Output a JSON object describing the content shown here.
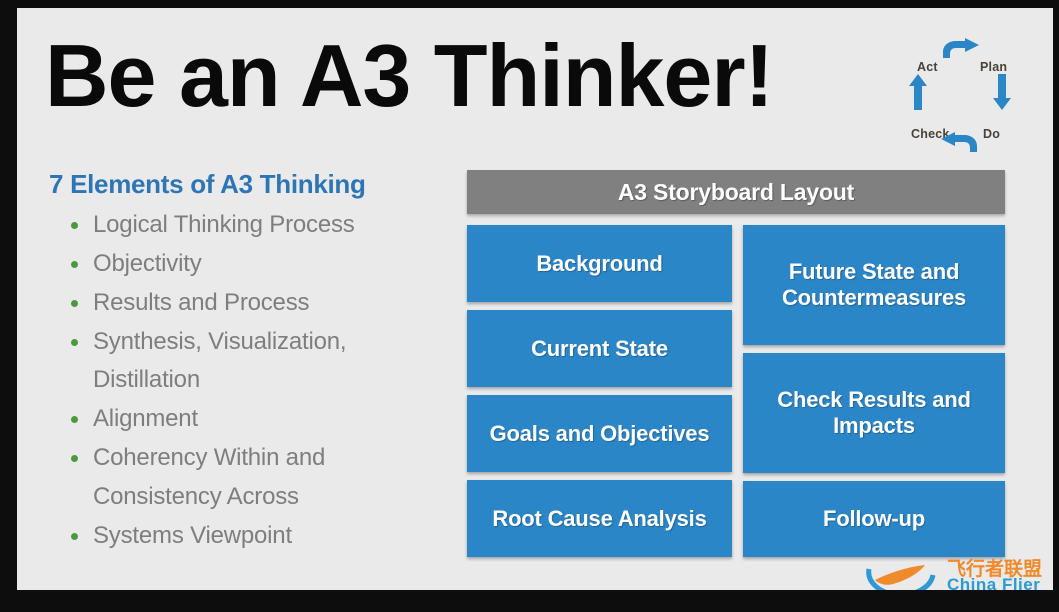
{
  "slide": {
    "title": "Be an A3 Thinker!",
    "background_color": "#eaeaea",
    "frame_color": "#0d0d0d"
  },
  "pdca": {
    "labels": {
      "act": "Act",
      "plan": "Plan",
      "check": "Check",
      "do": "Do"
    },
    "arrow_color": "#2b86c8",
    "label_color": "#4a4238",
    "icons": {
      "top": "arrow-right-icon",
      "right": "arrow-down-icon",
      "bottom": "arrow-left-icon",
      "left": "arrow-up-icon"
    }
  },
  "elements": {
    "heading": "7 Elements of A3 Thinking",
    "heading_color": "#2e75b6",
    "bullet_color": "#4a9a3c",
    "text_color": "#7e7e7e",
    "items": [
      {
        "line1": "Logical Thinking Process",
        "line2": ""
      },
      {
        "line1": "Objectivity",
        "line2": ""
      },
      {
        "line1": "Results and Process",
        "line2": ""
      },
      {
        "line1": "Synthesis, Visualization,",
        "line2": "Distillation"
      },
      {
        "line1": "Alignment",
        "line2": ""
      },
      {
        "line1": "Coherency Within and",
        "line2": "Consistency Across"
      },
      {
        "line1": "Systems Viewpoint",
        "line2": ""
      }
    ]
  },
  "storyboard": {
    "header": "A3 Storyboard Layout",
    "header_color": "#808080",
    "box_color": "#2b86c8",
    "left_column": [
      "Background",
      "Current State",
      "Goals and Objectives",
      "Root Cause Analysis"
    ],
    "right_column": [
      "Future State and Countermeasures",
      "Check Results and Impacts",
      "Follow-up"
    ]
  },
  "watermark": {
    "text_cn": "飞行者联盟",
    "text_en": "China Flier",
    "cn_color": "#f08a2a",
    "en_color": "#2b9ad6",
    "logo": "plane-orbit-logo"
  }
}
